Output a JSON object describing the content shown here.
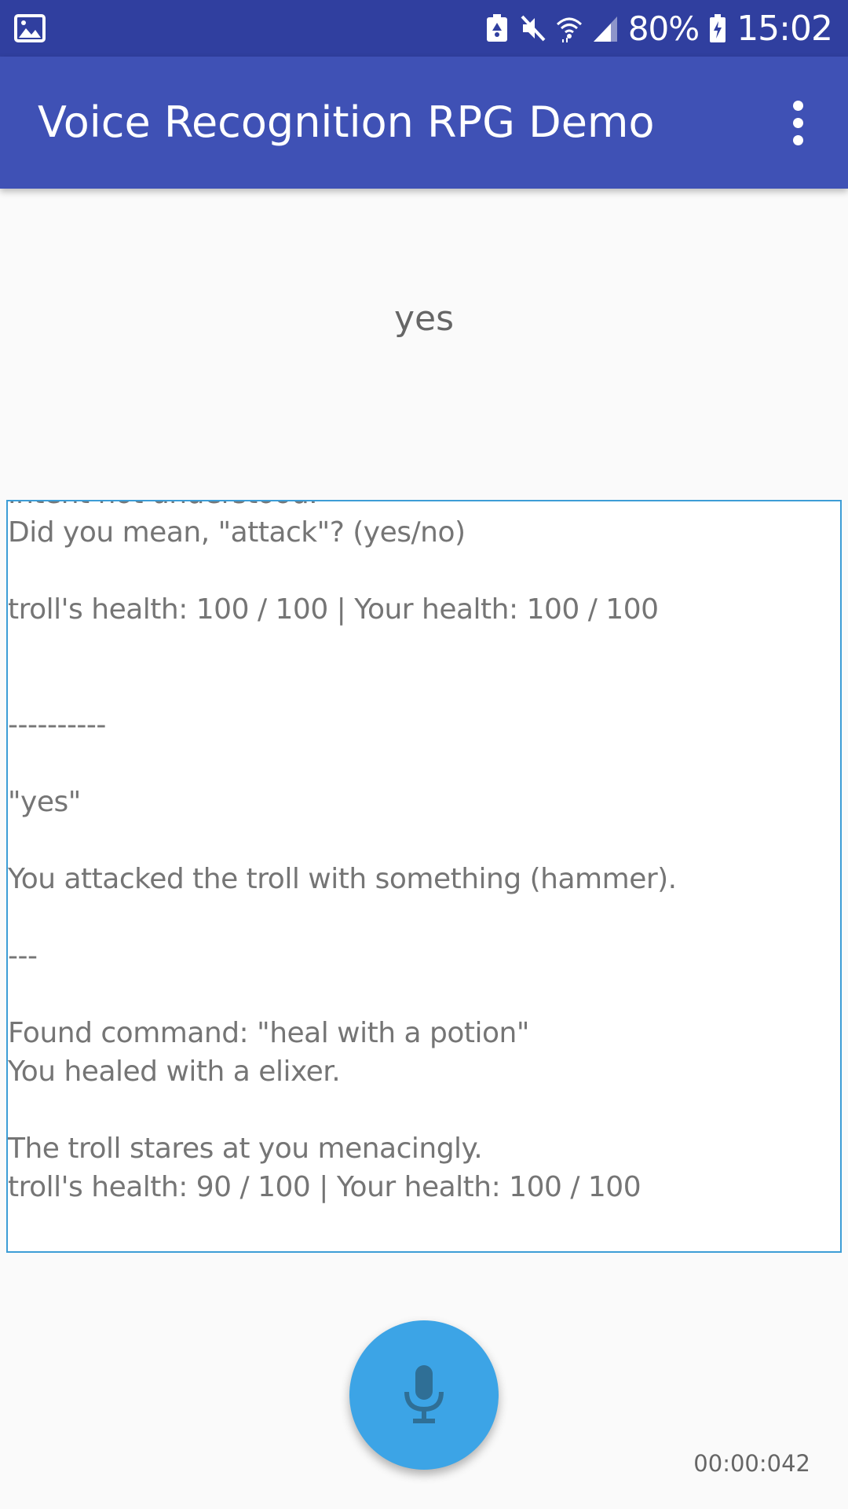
{
  "status_bar": {
    "left_icon": "image-icon",
    "icons": [
      "battery-saver-icon",
      "mute-icon",
      "wifi-icon",
      "signal-icon"
    ],
    "battery_percent": "80%",
    "battery_icon": "battery-charging-icon",
    "time": "15:02"
  },
  "app_bar": {
    "title": "Voice Recognition RPG Demo",
    "menu_icon": "more-vert-icon"
  },
  "recognized_text": "yes",
  "log": {
    "lines": [
      "Intent not understood.",
      "Did you mean, \"attack\"? (yes/no)",
      "",
      "troll's health: 100 / 100 | Your health: 100 / 100",
      "",
      "",
      "----------",
      "",
      "\"yes\"",
      "",
      "You attacked the troll with something (hammer).",
      "",
      "---",
      "",
      "Found command: \"heal with a potion\"",
      "You healed with a elixer.",
      "",
      "The troll stares at you menacingly.",
      "troll's health: 90 / 100 | Your health: 100 / 100"
    ]
  },
  "mic_button": {
    "icon": "microphone-icon"
  },
  "timer": "00:00:042",
  "colors": {
    "status_bar": "#303f9f",
    "app_bar": "#3f51b5",
    "accent": "#3ca4e6",
    "log_border": "#3d9dd6"
  }
}
